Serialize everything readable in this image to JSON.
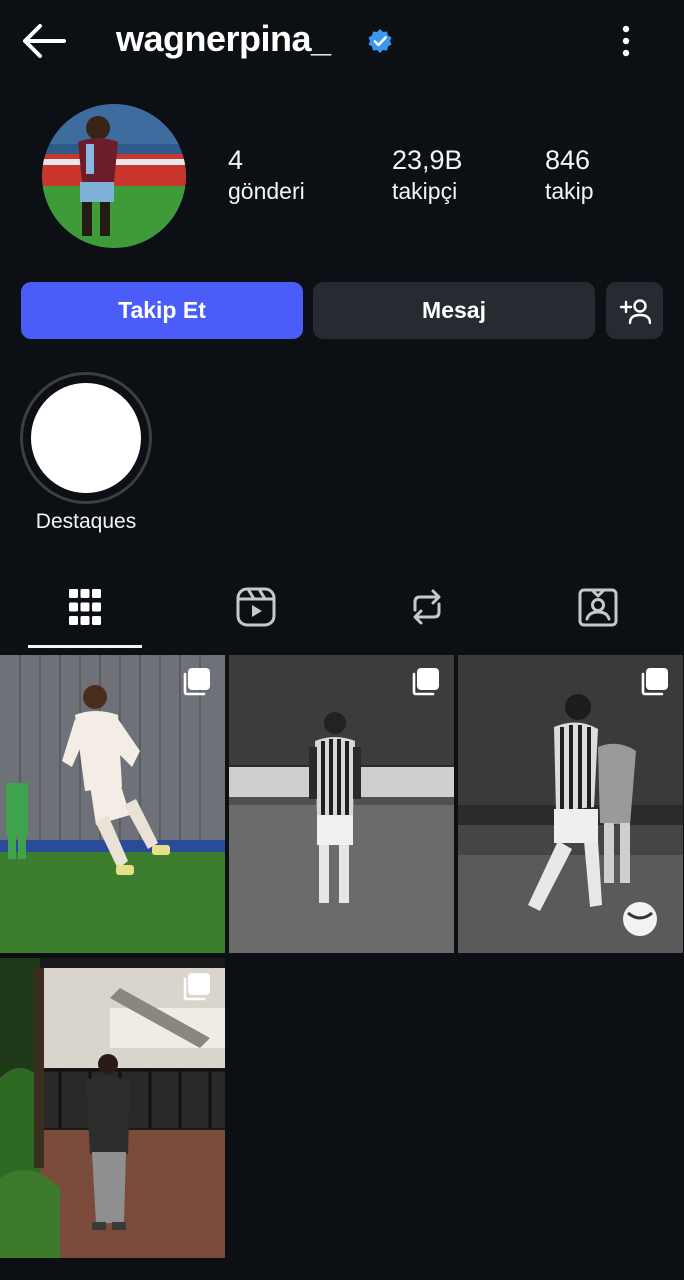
{
  "header": {
    "username": "wagnerpina_",
    "back_icon": "arrow-left-icon",
    "verified_icon": "verified-badge-icon",
    "more_icon": "more-vertical-icon"
  },
  "stats": [
    {
      "value": "4",
      "label": "gönderi"
    },
    {
      "value": "23,9B",
      "label": "takipçi"
    },
    {
      "value": "846",
      "label": "takip"
    }
  ],
  "actions": {
    "follow_label": "Takip Et",
    "message_label": "Mesaj",
    "add_icon": "add-person-icon"
  },
  "highlights": [
    {
      "label": "Destaques"
    }
  ],
  "tabs": [
    {
      "icon": "grid-icon",
      "active": true
    },
    {
      "icon": "reels-icon",
      "active": false
    },
    {
      "icon": "repost-icon",
      "active": false
    },
    {
      "icon": "tagged-icon",
      "active": false
    }
  ],
  "posts": [
    {
      "kind": "carousel",
      "color": "color"
    },
    {
      "kind": "carousel",
      "color": "bw"
    },
    {
      "kind": "carousel",
      "color": "bw"
    },
    {
      "kind": "carousel",
      "color": "color"
    }
  ],
  "colors": {
    "background": "#0c1014",
    "follow_button": "#4a5df9",
    "secondary_button": "#262a31",
    "verified": "#3897f0"
  }
}
